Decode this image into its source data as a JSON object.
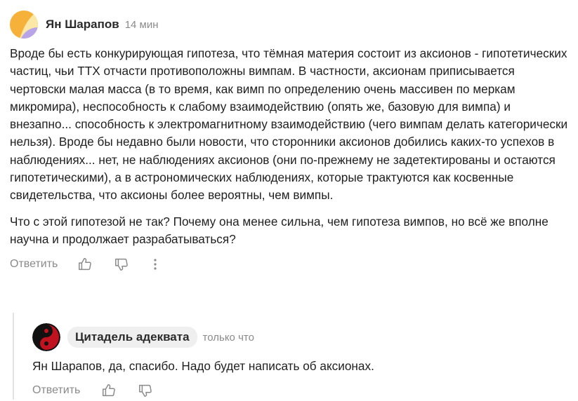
{
  "comment": {
    "author": "Ян Шарапов",
    "time": "14 мин",
    "avatar_icon": "orange-purple-avatar",
    "paragraphs": [
      "Вроде бы есть конкурирующая гипотеза, что тёмная материя состоит из аксионов - гипотетических частиц, чьи ТТХ отчасти противоположны вимпам. В частности, аксионам приписывается чертовски малая масса (в то время, как вимп по определению очень массивен по меркам микромира), неспособность к слабому взаимодействию (опять же, базовую для вимпа) и внезапно... способность к электромагнитному взаимодействию (чего вимпам делать категорически нельзя). Вроде бы недавно были новости, что сторонники аксионов добились каких-то успехов в наблюдениях... нет, не наблюдениях аксионов (они по-прежнему не задетектированы и остаются гипотетическими), а в астрономических наблюдениях, которые трактуются как косвенные свидетельства, что аксионы более вероятны, чем вимпы.",
      "Что с этой гипотезой не так? Почему она менее сильна, чем гипотеза вимпов, но всё же вполне научна и продолжает разрабатываться?"
    ],
    "actions": {
      "reply_label": "Ответить",
      "like_icon": "thumbs-up-icon",
      "dislike_icon": "thumbs-down-icon",
      "more_icon": "more-vertical-icon"
    }
  },
  "reply": {
    "author": "Цитадель адеквата",
    "time": "только что",
    "avatar_icon": "yin-yang-red-black-avatar",
    "text": "Ян Шарапов, да, спасибо. Надо будет написать об аксионах.",
    "actions": {
      "reply_label": "Ответить",
      "like_icon": "thumbs-up-icon",
      "dislike_icon": "thumbs-down-icon"
    }
  },
  "colors": {
    "muted": "#8a8a8a",
    "chip_bg": "#efefef",
    "thread_line": "#e2e2e2"
  }
}
